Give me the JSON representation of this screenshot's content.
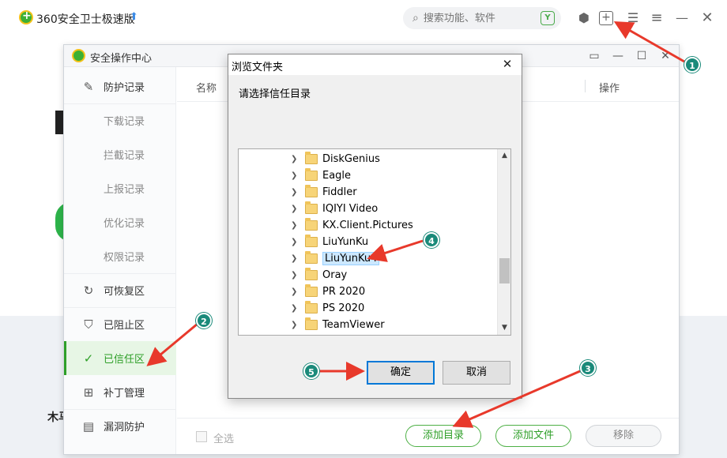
{
  "app": {
    "title": "360安全卫士极速版",
    "search_placeholder": "搜索功能、软件"
  },
  "safety_center": {
    "title": "安全操作中心",
    "sidebar": {
      "items": [
        {
          "label": "防护记录",
          "icon": "edit-icon"
        },
        {
          "label": "下载记录"
        },
        {
          "label": "拦截记录"
        },
        {
          "label": "上报记录"
        },
        {
          "label": "优化记录"
        },
        {
          "label": "权限记录"
        },
        {
          "label": "可恢复区",
          "icon": "refresh-icon"
        },
        {
          "label": "已阻止区",
          "icon": "shield-icon"
        },
        {
          "label": "已信任区",
          "icon": "shield-check-icon",
          "active": true
        },
        {
          "label": "补丁管理",
          "icon": "grid-icon"
        },
        {
          "label": "漏洞防护",
          "icon": "document-icon"
        }
      ]
    },
    "table": {
      "col_name": "名称",
      "col_op": "操作"
    },
    "footer": {
      "select_all": "全选",
      "add_dir": "添加目录",
      "add_file": "添加文件",
      "remove": "移除"
    }
  },
  "dialog": {
    "title": "浏览文件夹",
    "prompt": "请选择信任目录",
    "folders": [
      "DiskGenius",
      "Eagle",
      "Fiddler",
      "IQIYI Video",
      "KX.Client.Pictures",
      "LiuYunKu",
      "LiuYunKu4",
      "Oray",
      "PR 2020",
      "PS 2020",
      "TeamViewer"
    ],
    "selected_folder": "LiuYunKu4",
    "ok": "确定",
    "cancel": "取消"
  },
  "annotations": [
    "1",
    "2",
    "3",
    "4",
    "5"
  ],
  "behind": {
    "partial_text": "木马"
  }
}
